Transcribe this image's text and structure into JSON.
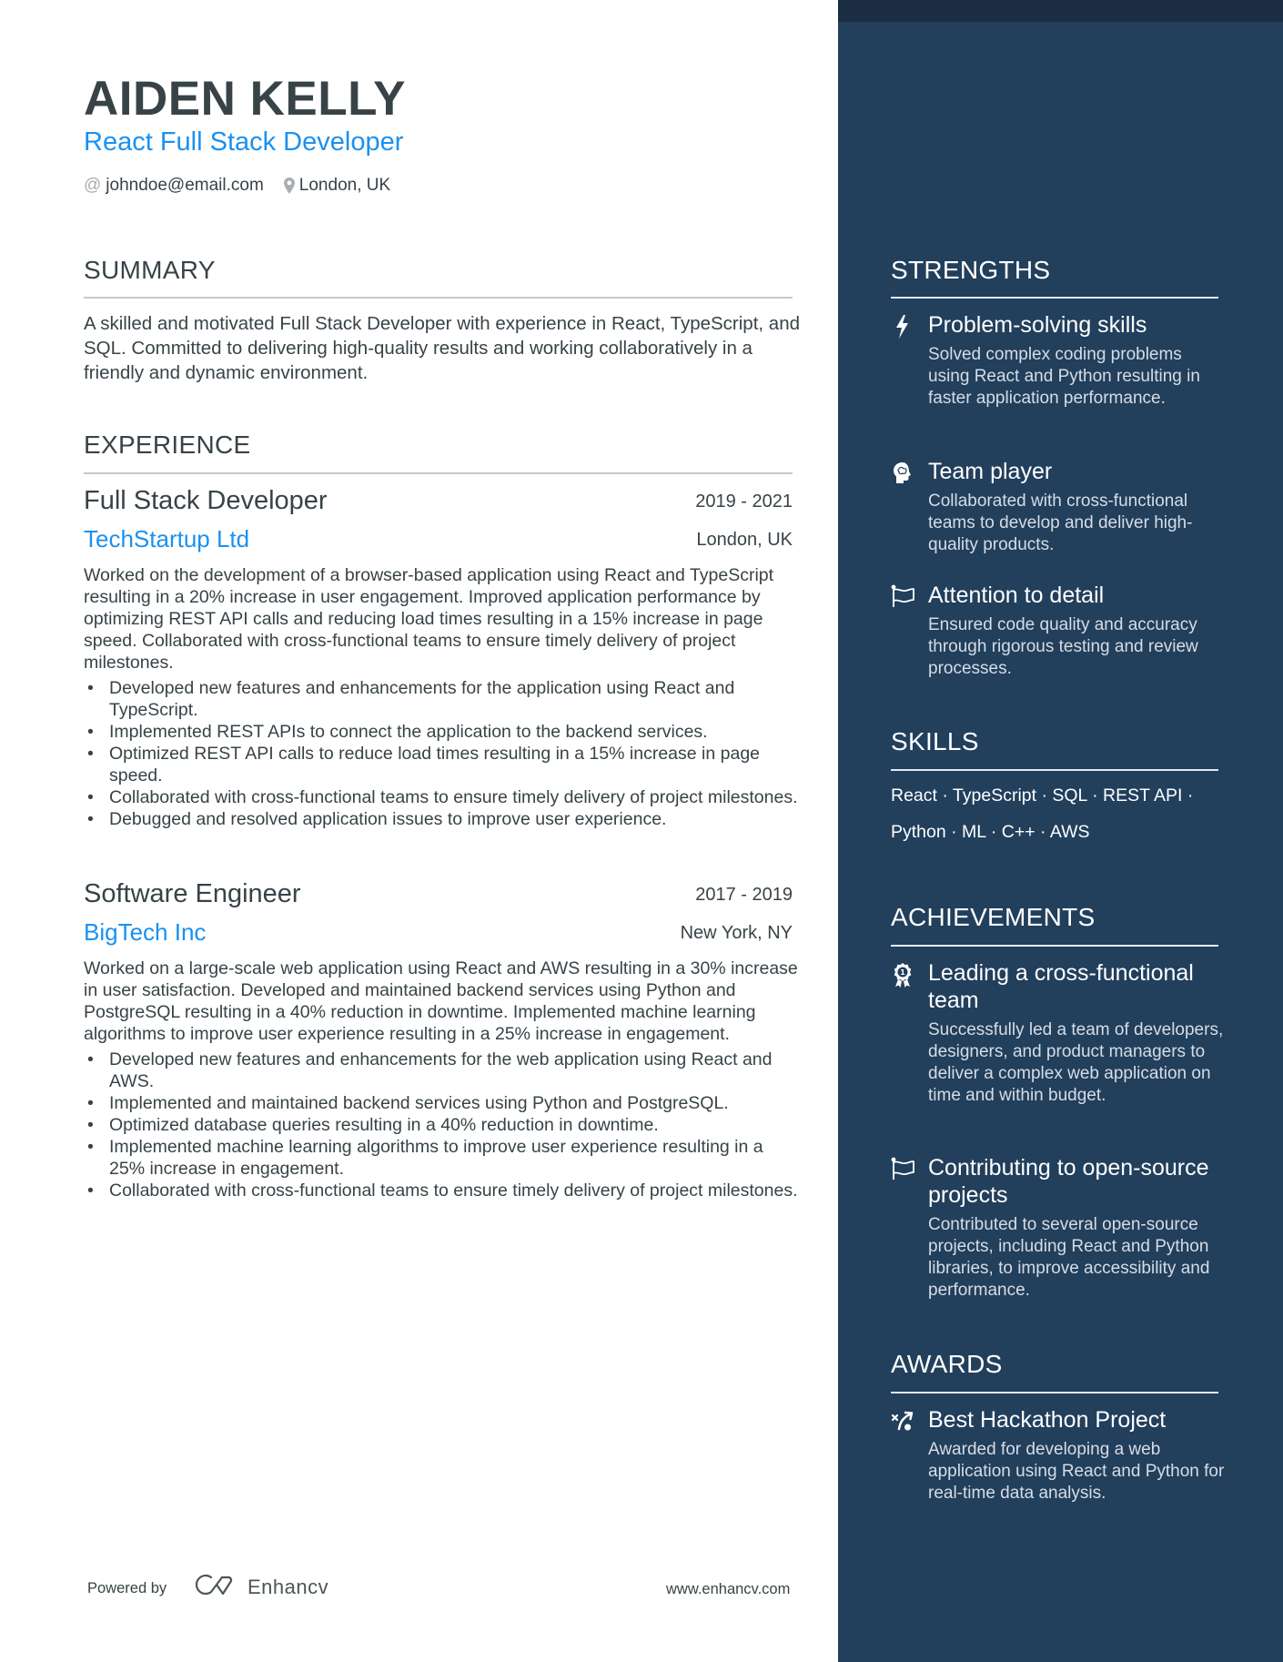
{
  "header": {
    "name": "AIDEN KELLY",
    "role": "React Full Stack Developer",
    "contacts": [
      {
        "icon": "at-icon",
        "text": "johndoe@email.com"
      },
      {
        "icon": "location-pin-icon",
        "text": "London, UK"
      }
    ]
  },
  "summary": {
    "title": "SUMMARY",
    "text": "A skilled and motivated Full Stack Developer with experience in React, TypeScript, and SQL. Committed to delivering high-quality results and working collaboratively in a friendly and dynamic environment."
  },
  "experience": {
    "title": "EXPERIENCE",
    "jobs": [
      {
        "title": "Full Stack Developer",
        "dates": "2019 - 2021",
        "company": "TechStartup Ltd",
        "location": "London, UK",
        "description": "Worked on the development of a browser-based application using React and TypeScript resulting in a 20% increase in user engagement. Improved application performance by optimizing REST API calls and reducing load times resulting in a 15% increase in page speed. Collaborated with cross-functional teams to ensure timely delivery of project milestones.",
        "bullets": [
          "Developed new features and enhancements for the application using React and TypeScript.",
          "Implemented REST APIs to connect the application to the backend services.",
          "Optimized REST API calls to reduce load times resulting in a 15% increase in page speed.",
          "Collaborated with cross-functional teams to ensure timely delivery of project milestones.",
          "Debugged and resolved application issues to improve user experience."
        ]
      },
      {
        "title": "Software Engineer",
        "dates": "2017 - 2019",
        "company": "BigTech Inc",
        "location": "New York, NY",
        "description": "Worked on a large-scale web application using React and AWS resulting in a 30% increase in user satisfaction. Developed and maintained backend services using Python and PostgreSQL resulting in a 40% reduction in downtime. Implemented machine learning algorithms to improve user experience resulting in a 25% increase in engagement.",
        "bullets": [
          "Developed new features and enhancements for the web application using React and AWS.",
          "Implemented and maintained backend services using Python and PostgreSQL.",
          "Optimized database queries resulting in a 40% reduction in downtime.",
          "Implemented machine learning algorithms to improve user experience resulting in a 25% increase in engagement.",
          "Collaborated with cross-functional teams to ensure timely delivery of project milestones."
        ]
      }
    ]
  },
  "strengths": {
    "title": "STRENGTHS",
    "items": [
      {
        "icon": "lightning-bolt-icon",
        "title": "Problem-solving skills",
        "description": "Solved complex coding problems using React and Python resulting in faster application performance."
      },
      {
        "icon": "head-brain-icon",
        "title": "Team player",
        "description": "Collaborated with cross-functional teams to develop and deliver high-quality products."
      },
      {
        "icon": "flag-icon",
        "title": "Attention to detail",
        "description": "Ensured code quality and accuracy through rigorous testing and review processes."
      }
    ]
  },
  "skills": {
    "title": "SKILLS",
    "line1": "React · TypeScript · SQL · REST API ·",
    "line2": "Python · ML · C++ · AWS"
  },
  "achievements": {
    "title": "ACHIEVEMENTS",
    "items": [
      {
        "icon": "award-ribbon-icon",
        "title": "Leading a cross-functional team",
        "description": "Successfully led a team of developers, designers, and product managers to deliver a complex web application on time and within budget."
      },
      {
        "icon": "flag-icon",
        "title": "Contributing to open-source projects",
        "description": "Contributed to several open-source projects, including React and Python libraries, to improve accessibility and performance."
      }
    ]
  },
  "awards": {
    "title": "AWARDS",
    "items": [
      {
        "icon": "strategy-play-icon",
        "title": "Best Hackathon Project",
        "description": "Awarded for developing a web application using React and Python for real-time data analysis."
      }
    ]
  },
  "footer": {
    "powered_by": "Powered by",
    "brand": "Enhancv",
    "url": "www.enhancv.com"
  },
  "colors": {
    "accent": "#1a91f0",
    "text": "#384347",
    "sidebar": "#223f5c",
    "sidebar_top": "#1b2d43"
  }
}
